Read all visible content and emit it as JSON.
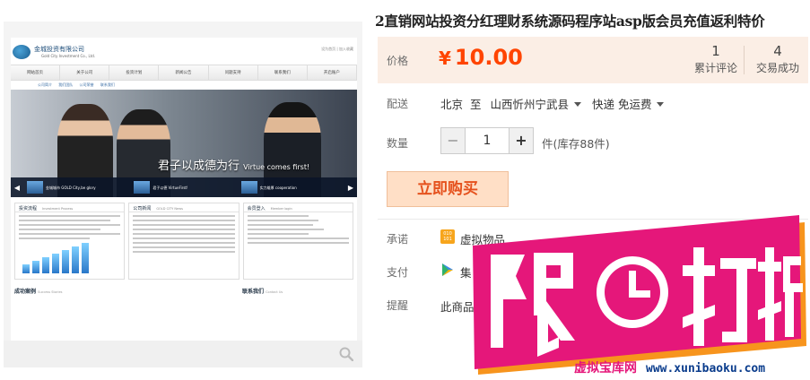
{
  "product": {
    "title": "2直销网站投资分红理财系统源码程序站asp版会员充值返利特价"
  },
  "price_box": {
    "label": "价格",
    "currency": "¥",
    "amount": "10.00",
    "reviews_count": "1",
    "reviews_label": "累计评论",
    "deals_count": "4",
    "deals_label": "交易成功"
  },
  "shipping": {
    "label": "配送",
    "from": "北京",
    "to_word": "至",
    "destination": "山西忻州宁武县",
    "method": "快递 免运费"
  },
  "quantity": {
    "label": "数量",
    "minus": "−",
    "value": "1",
    "plus": "+",
    "stock": "件(库存88件)"
  },
  "buy_button": "立即购买",
  "promise": {
    "label": "承诺",
    "icon_text": "010 101",
    "text": "虚拟物品"
  },
  "payment": {
    "label": "支付",
    "text": "集"
  },
  "remind": {
    "label": "提醒",
    "text": "此商品"
  },
  "promo": {
    "badge_text": "限时打折",
    "site_name": "虚拟宝库网",
    "site_url": "www.xunibaoku.com",
    "colors": {
      "magenta": "#e5177a",
      "orange": "#f7941d",
      "navy": "#0a3c8c"
    }
  },
  "preview": {
    "company": "金城投资有限公司",
    "company_en": "Gold City Investment Co., Ltd.",
    "top_links": "设为首页 | 加入收藏",
    "nav": [
      "网站首页",
      "关于公司",
      "投资计划",
      "新闻公告",
      "问题支持",
      "联系我们",
      "开启账户"
    ],
    "subnav": "公司简介  我们团队  公司荣誉  联系我们",
    "banner_slogan": "君子以成德为行",
    "banner_slogan_en": "Virtue comes first!",
    "thumbs": [
      "金城城市 GOLD City,be glory",
      "君子以德 VirtueFirst!",
      "实力雄厚 cooperation"
    ],
    "panels": [
      {
        "title": "投资流程",
        "sub": "Investment Process"
      },
      {
        "title": "公司新闻",
        "sub": "GOLD CITY News"
      },
      {
        "title": "会员登入",
        "sub": "Member login"
      }
    ],
    "bottom": [
      {
        "title": "成功案例",
        "sub": "Success Stories"
      },
      {
        "title": "联系我们",
        "sub": "Contact Us"
      }
    ]
  }
}
